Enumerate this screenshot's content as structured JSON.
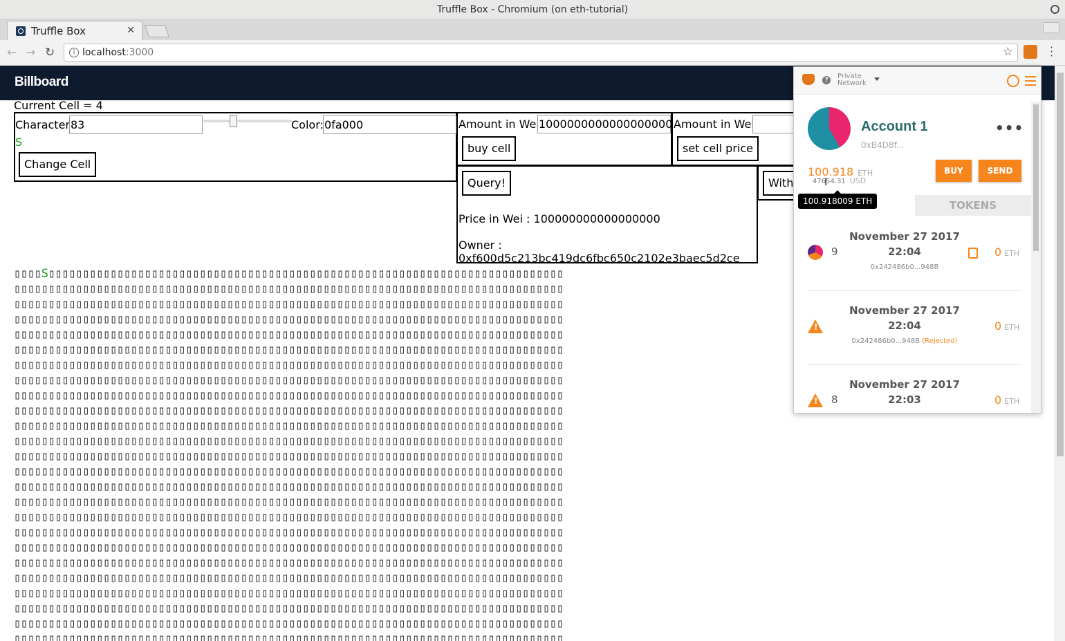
{
  "window": {
    "title": "Truffle Box - Chromium (on eth-tutorial)"
  },
  "browser": {
    "tab_title": "Truffle Box",
    "url_host": "localhost",
    "url_port": ":3000"
  },
  "navbar": {
    "brand": "Billboard"
  },
  "current_cell": "Current Cell = 4",
  "change_panel": {
    "character_label": "Character:",
    "character_value": "83",
    "color_label": "Color:",
    "color_value": "0fa000",
    "preview_char": "S",
    "change_button": "Change Cell"
  },
  "buy_panel": {
    "amount_label": "Amount in Wei:",
    "amount_value": "1000000000000000000",
    "buy_button": "buy cell"
  },
  "price_panel": {
    "amount_label": "Amount in Wei:",
    "amount_value": "",
    "set_button": "set cell price"
  },
  "query_panel": {
    "query_button": "Query!",
    "price_text": "Price in Wei : 100000000000000000",
    "owner_text": "Owner : 0xf600d5c213bc419dc6fbc650c2102e3baec5d2ce"
  },
  "withdraw_panel": {
    "button_partial": "Witho"
  },
  "billboard": {
    "highlight_char": "S",
    "highlight_color": "#16a016",
    "placeholder_glyph": "▯"
  },
  "metamask": {
    "network_line1": "Private",
    "network_line2": "Network",
    "account_name": "Account 1",
    "account_address": "0xB4D8f...",
    "more": "•••",
    "balance_eth": "100.918",
    "balance_eth_unit": "ETH",
    "balance_usd": "47654.31",
    "balance_usd_unit": "USD",
    "buy_button": "BUY",
    "send_button": "SEND",
    "tooltip": "100.918009 ETH",
    "tokens_tab": "TOKENS",
    "accent_color": "#f6851b",
    "transactions": [
      {
        "nonce": "9",
        "date": "November 27 2017",
        "time": "22:04",
        "hash": "0x242486b0...948B",
        "status": "",
        "amount": "0",
        "unit": "ETH",
        "icon": "identicon"
      },
      {
        "nonce": "",
        "date": "November 27 2017",
        "time": "22:04",
        "hash": "0x242486b0...948B",
        "status": "(Rejected)",
        "amount": "0",
        "unit": "ETH",
        "icon": "warning-icon"
      },
      {
        "nonce": "8",
        "date": "November 27 2017",
        "time": "22:03",
        "hash": "",
        "status": "",
        "amount": "0",
        "unit": "ETH",
        "icon": "warning-icon"
      }
    ]
  }
}
